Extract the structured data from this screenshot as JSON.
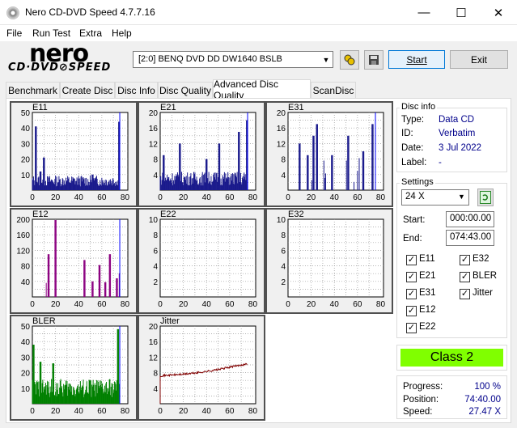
{
  "window": {
    "title": "Nero CD-DVD Speed 4.7.7.16"
  },
  "menu": [
    "File",
    "Run Test",
    "Extra",
    "Help"
  ],
  "logo": {
    "line1": "nero",
    "line2": "CD·DVD⊘SPEED"
  },
  "toolbar": {
    "drive": "[2:0]  BENQ DVD DD DW1640 BSLB",
    "start": "Start",
    "exit": "Exit"
  },
  "tabs": [
    "Benchmark",
    "Create Disc",
    "Disc Info",
    "Disc Quality",
    "Advanced Disc Quality",
    "ScanDisc"
  ],
  "disc_info": {
    "heading": "Disc info",
    "type_label": "Type:",
    "type": "Data CD",
    "id_label": "ID:",
    "id": "Verbatim",
    "date_label": "Date:",
    "date": "3 Jul 2022",
    "label_label": "Label:",
    "label": "-"
  },
  "settings": {
    "heading": "Settings",
    "speed": "24 X",
    "start_label": "Start:",
    "start": "000:00.00",
    "end_label": "End:",
    "end": "074:43.00"
  },
  "checkboxes": [
    {
      "label": "E11",
      "checked": true
    },
    {
      "label": "E32",
      "checked": true
    },
    {
      "label": "E21",
      "checked": true
    },
    {
      "label": "BLER",
      "checked": true
    },
    {
      "label": "E31",
      "checked": true
    },
    {
      "label": "Jitter",
      "checked": true
    },
    {
      "label": "E12",
      "checked": true
    },
    {
      "label": "E22",
      "checked": true
    }
  ],
  "class_badge": "Class 2",
  "status": {
    "progress_label": "Progress:",
    "progress": "100 %",
    "position_label": "Position:",
    "position": "74:40.00",
    "speed_label": "Speed:",
    "speed": "27.47 X"
  },
  "colors": {
    "class_bg": "#80ff00",
    "e_series": "#1a1a8c",
    "e12": "#8c0080",
    "bler": "#008000",
    "jitter": "#800000"
  },
  "chart_data": [
    {
      "type": "bar",
      "title": "E11",
      "ylim": [
        0,
        50
      ],
      "yticks": [
        10,
        20,
        30,
        40,
        50
      ],
      "xticks": [
        0,
        20,
        40,
        60,
        80
      ],
      "color": "#1a1a8c",
      "profile": {
        "base": 6,
        "spikes": [
          [
            3,
            41
          ],
          [
            7,
            12
          ],
          [
            10,
            21
          ],
          [
            52,
            10
          ],
          [
            75,
            44
          ]
        ]
      }
    },
    {
      "type": "bar",
      "title": "E21",
      "ylim": [
        0,
        20
      ],
      "yticks": [
        4,
        8,
        12,
        16,
        20
      ],
      "xticks": [
        0,
        20,
        40,
        60,
        80
      ],
      "color": "#1a1a8c",
      "profile": {
        "base": 3,
        "spikes": [
          [
            3,
            9
          ],
          [
            17,
            12
          ],
          [
            40,
            8
          ],
          [
            51,
            12
          ],
          [
            68,
            15
          ],
          [
            75,
            18
          ]
        ]
      }
    },
    {
      "type": "bar",
      "title": "E31",
      "ylim": [
        0,
        20
      ],
      "yticks": [
        4,
        8,
        12,
        16,
        20
      ],
      "xticks": [
        0,
        20,
        40,
        60,
        80
      ],
      "color": "#1a1a8c",
      "profile": {
        "base": 0,
        "spikes": [
          [
            10,
            12
          ],
          [
            17,
            9
          ],
          [
            22,
            14
          ],
          [
            25,
            17
          ],
          [
            38,
            9
          ],
          [
            52,
            14
          ],
          [
            65,
            10
          ],
          [
            73,
            17
          ],
          [
            77,
            14
          ]
        ]
      }
    },
    {
      "type": "bar",
      "title": "E12",
      "ylim": [
        0,
        200
      ],
      "yticks": [
        40,
        80,
        120,
        160,
        200
      ],
      "xticks": [
        0,
        20,
        40,
        60,
        80
      ],
      "color": "#8c0080",
      "profile": {
        "base": 0,
        "spikes": [
          [
            14,
            110
          ],
          [
            20,
            198
          ],
          [
            45,
            95
          ],
          [
            52,
            40
          ],
          [
            58,
            82
          ],
          [
            63,
            38
          ],
          [
            67,
            110
          ],
          [
            73,
            48
          ],
          [
            77,
            148
          ]
        ]
      }
    },
    {
      "type": "bar",
      "title": "E22",
      "ylim": [
        0,
        10
      ],
      "yticks": [
        2,
        4,
        6,
        8,
        10
      ],
      "xticks": [
        0,
        20,
        40,
        60,
        80
      ],
      "color": "#1a1a8c",
      "profile": {
        "base": 0,
        "spikes": []
      }
    },
    {
      "type": "bar",
      "title": "E32",
      "ylim": [
        0,
        10
      ],
      "yticks": [
        2,
        4,
        6,
        8,
        10
      ],
      "xticks": [
        0,
        20,
        40,
        60,
        80
      ],
      "color": "#1a1a8c",
      "profile": {
        "base": 0,
        "spikes": []
      }
    },
    {
      "type": "bar",
      "title": "BLER",
      "ylim": [
        0,
        50
      ],
      "yticks": [
        10,
        20,
        30,
        40,
        50
      ],
      "xticks": [
        0,
        20,
        40,
        60,
        80
      ],
      "color": "#008000",
      "profile": {
        "base": 10,
        "spikes": [
          [
            1,
            38
          ],
          [
            7,
            27
          ],
          [
            18,
            26
          ],
          [
            50,
            15
          ],
          [
            74,
            48
          ]
        ]
      }
    },
    {
      "type": "line",
      "title": "Jitter",
      "ylim": [
        0,
        20
      ],
      "yticks": [
        4,
        8,
        12,
        16,
        20
      ],
      "xticks": [
        0,
        20,
        40,
        60,
        80
      ],
      "color": "#800000",
      "x": [
        0,
        10,
        20,
        30,
        40,
        50,
        60,
        70,
        80
      ],
      "y": [
        7.2,
        7.4,
        7.6,
        7.9,
        8.3,
        8.8,
        9.4,
        10.0,
        10.4
      ]
    }
  ]
}
